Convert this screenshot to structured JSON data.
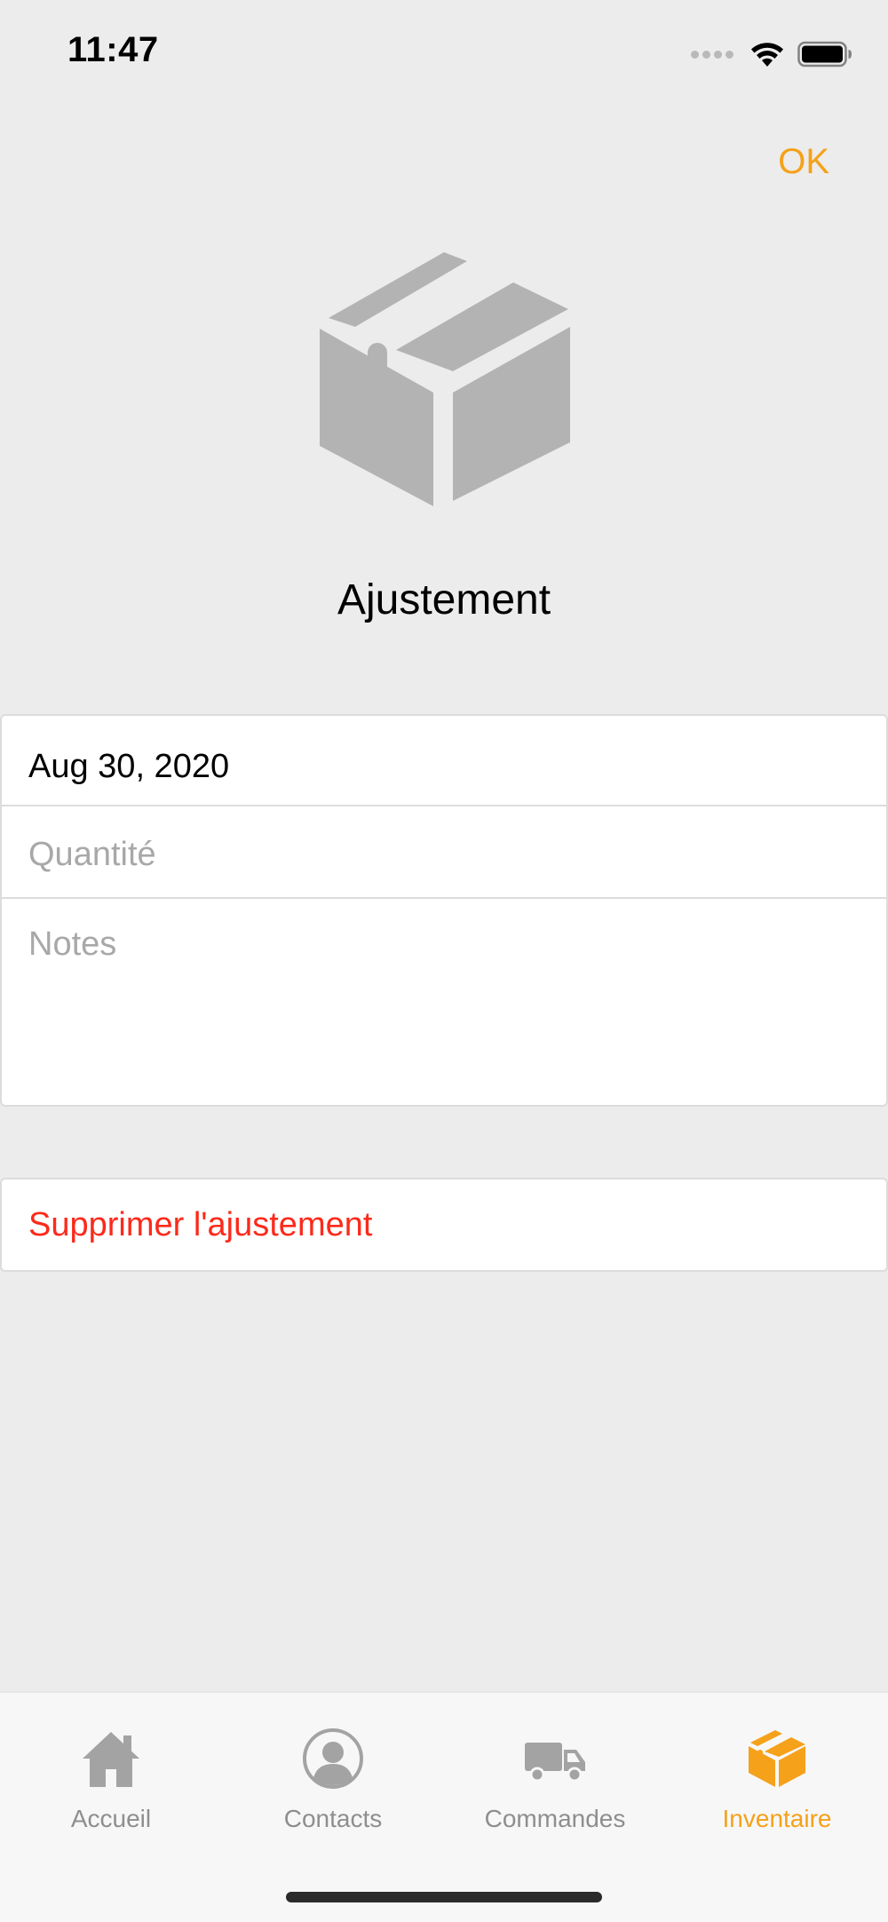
{
  "status_bar": {
    "time": "11:47",
    "signal_icon": "cellular-signal-icon",
    "wifi_icon": "wifi-icon",
    "battery_icon": "battery-icon"
  },
  "nav": {
    "ok_label": "OK",
    "accent_color": "#f5a11a"
  },
  "header": {
    "icon": "box-icon",
    "title": "Ajustement"
  },
  "form": {
    "date_value": "Aug 30, 2020",
    "quantity_placeholder": "Quantité",
    "quantity_value": "",
    "notes_placeholder": "Notes",
    "notes_value": ""
  },
  "actions": {
    "delete_label": "Supprimer l'ajustement",
    "delete_color": "#fc2a1b"
  },
  "tabs": [
    {
      "label": "Accueil",
      "icon": "house-icon",
      "active": false
    },
    {
      "label": "Contacts",
      "icon": "person-icon",
      "active": false
    },
    {
      "label": "Commandes",
      "icon": "truck-icon",
      "active": false
    },
    {
      "label": "Inventaire",
      "icon": "box-icon",
      "active": true
    }
  ]
}
